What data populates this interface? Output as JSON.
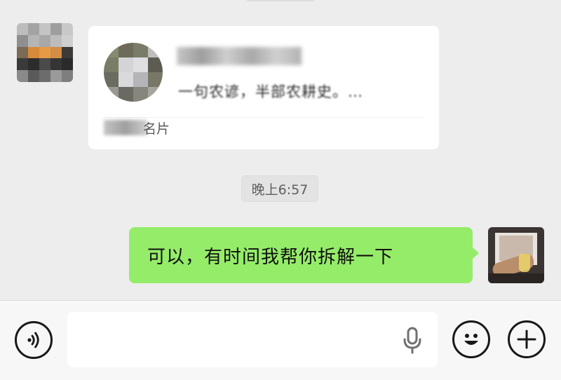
{
  "chat": {
    "card": {
      "description": "一句农谚，半部农耕史。…",
      "footer_label": "名片"
    },
    "timestamp": "晚上6:57",
    "outgoing_message": "可以，有时间我帮你拆解一下"
  },
  "input_bar": {
    "placeholder": "",
    "icons": [
      "voice-icon",
      "microphone-icon",
      "emoji-icon",
      "plus-icon"
    ]
  },
  "colors": {
    "background": "#ededed",
    "outgoing_bubble": "#95ec69",
    "card": "#ffffff",
    "input_bar": "#f7f7f7"
  }
}
